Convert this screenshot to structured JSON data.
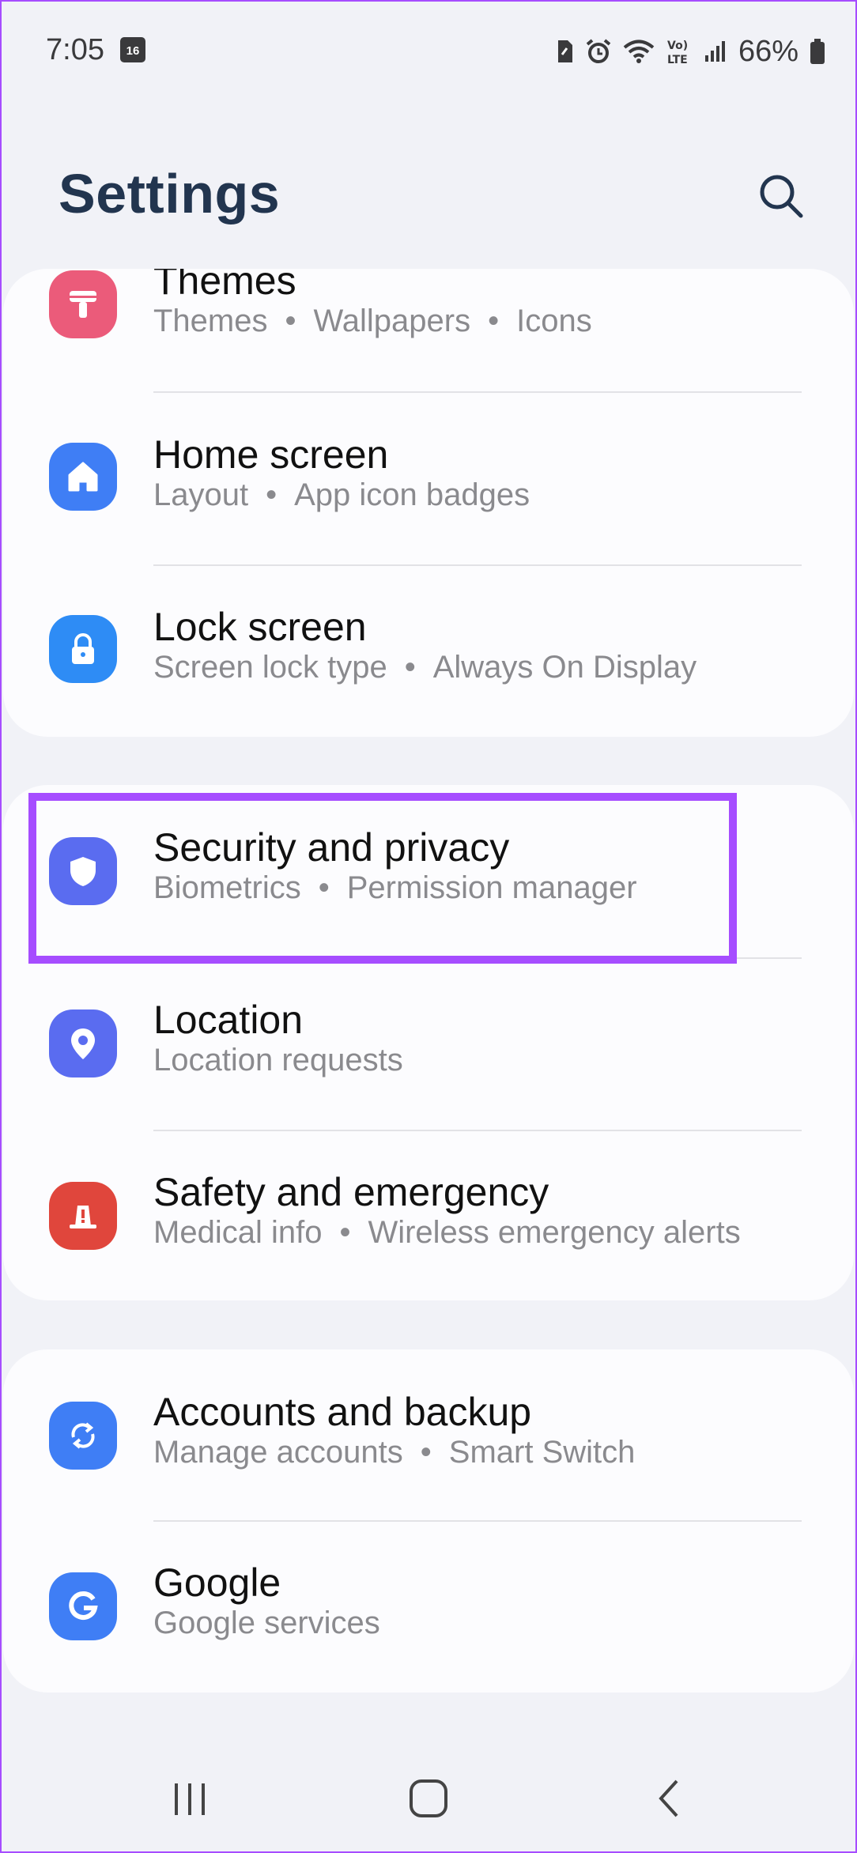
{
  "status_bar": {
    "time": "7:05",
    "calendar_day": "16",
    "battery_percent": "66%",
    "icons": [
      "sim-icon",
      "alarm-icon",
      "wifi-icon",
      "volte-icon",
      "signal-icon",
      "battery-icon"
    ]
  },
  "header": {
    "title": "Settings",
    "search_icon": "search-icon"
  },
  "groups": [
    {
      "items": [
        {
          "title": "Themes",
          "subtitle": [
            "Themes",
            "Wallpapers",
            "Icons"
          ],
          "icon": "brush-icon",
          "icon_color": "#eb5b7a"
        },
        {
          "title": "Home screen",
          "subtitle": [
            "Layout",
            "App icon badges"
          ],
          "icon": "home-icon",
          "icon_color": "#3f7ef5"
        },
        {
          "title": "Lock screen",
          "subtitle": [
            "Screen lock type",
            "Always On Display"
          ],
          "icon": "lock-icon",
          "icon_color": "#2e8cf5"
        }
      ]
    },
    {
      "items": [
        {
          "title": "Security and privacy",
          "subtitle": [
            "Biometrics",
            "Permission manager"
          ],
          "icon": "shield-icon",
          "icon_color": "#5a6cf0",
          "highlighted": true
        },
        {
          "title": "Location",
          "subtitle": [
            "Location requests"
          ],
          "icon": "location-pin-icon",
          "icon_color": "#5a6cf0"
        },
        {
          "title": "Safety and emergency",
          "subtitle": [
            "Medical info",
            "Wireless emergency alerts"
          ],
          "icon": "emergency-icon",
          "icon_color": "#e0463c"
        }
      ]
    },
    {
      "items": [
        {
          "title": "Accounts and backup",
          "subtitle": [
            "Manage accounts",
            "Smart Switch"
          ],
          "icon": "sync-icon",
          "icon_color": "#3f7ef5"
        },
        {
          "title": "Google",
          "subtitle": [
            "Google services"
          ],
          "icon": "google-icon",
          "icon_color": "#3f7ef5"
        }
      ]
    }
  ],
  "dot_separator": "•",
  "nav_bar": {
    "buttons": [
      "recents-icon",
      "home-icon",
      "back-icon"
    ]
  },
  "colors": {
    "background": "#f1f2f7",
    "card": "#fcfcfe",
    "title": "#22354f",
    "highlight": "#a64dff"
  }
}
